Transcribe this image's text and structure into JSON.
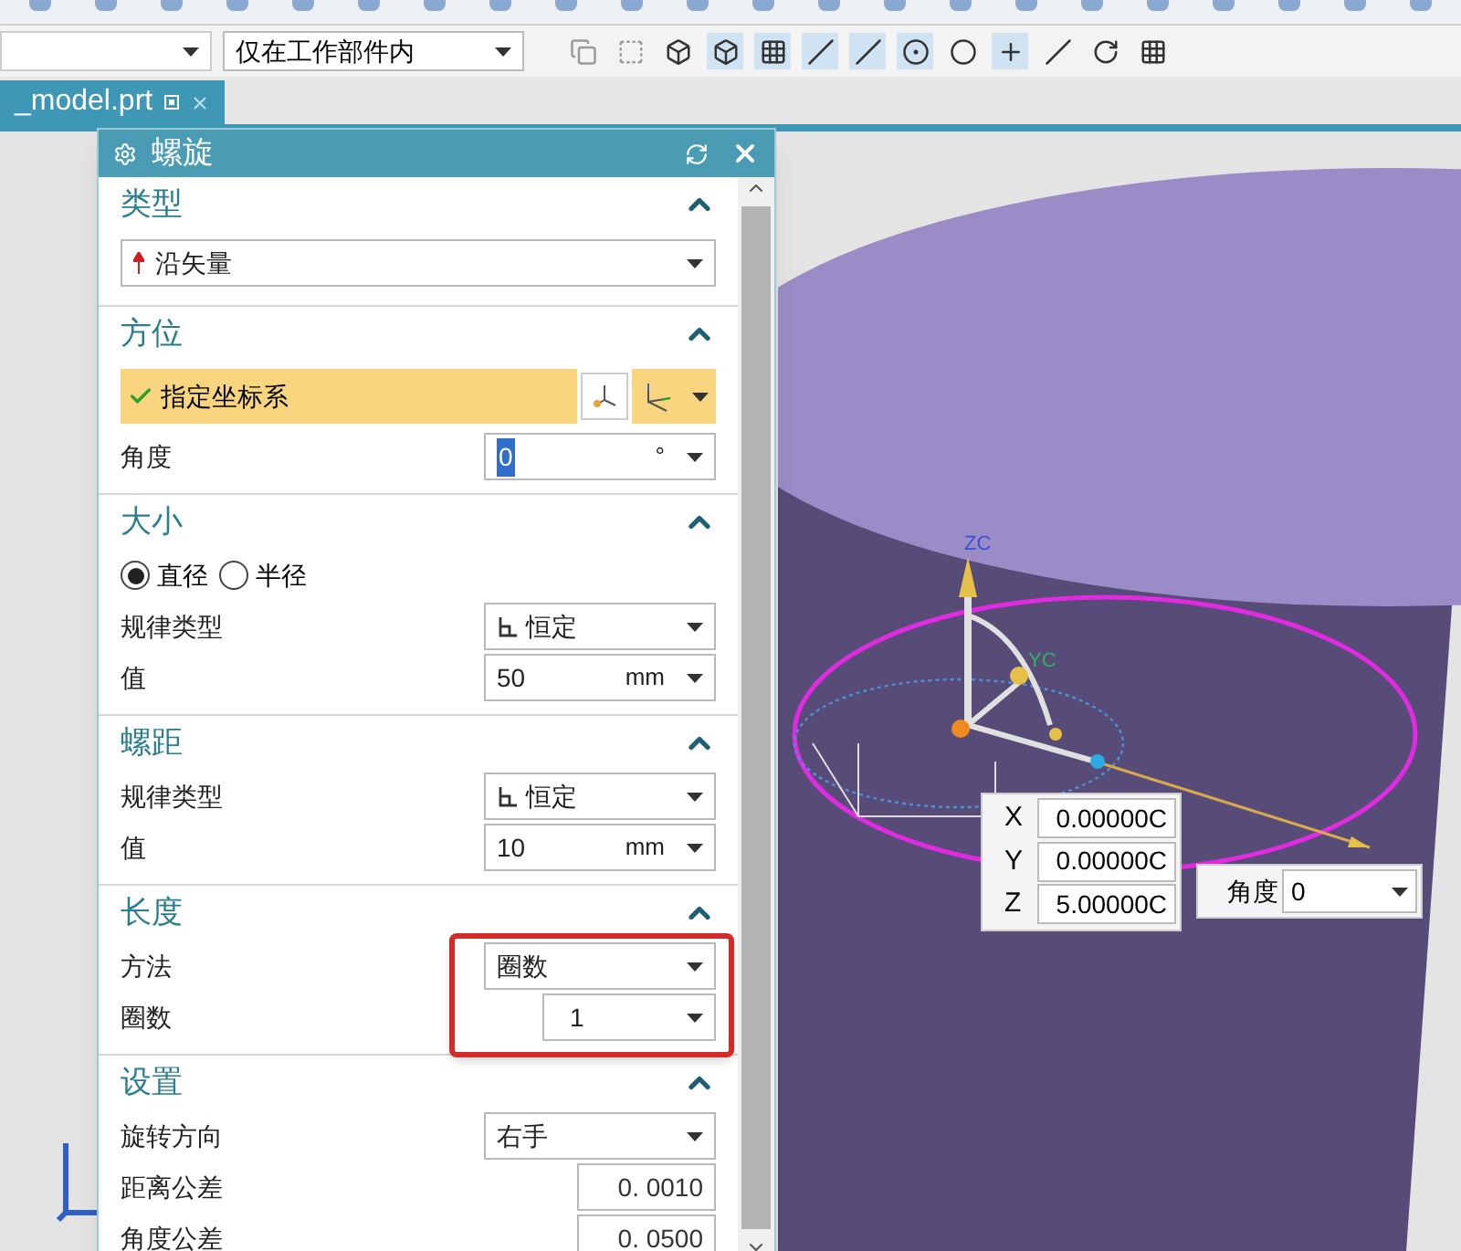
{
  "toolbar": {
    "filter_dropdown": {
      "value": "仅在工作部件内"
    }
  },
  "tabs": [
    {
      "label": "_model.prt",
      "selected": true
    }
  ],
  "dialog": {
    "title": "螺旋",
    "sections": [
      {
        "title": "类型",
        "expanded": true,
        "highlighted": false,
        "rows": [
          {
            "kind": "type_select",
            "value": "沿矢量"
          }
        ]
      },
      {
        "title": "方位",
        "expanded": true,
        "highlighted": false,
        "rows": [
          {
            "kind": "selection",
            "label": "指定坐标系",
            "checked": true
          },
          {
            "kind": "field",
            "label": "角度",
            "value": "0",
            "unit": "°",
            "text_selected": true
          }
        ]
      },
      {
        "title": "大小",
        "expanded": true,
        "highlighted": false,
        "rows": [
          {
            "kind": "radio",
            "options": [
              {
                "label": "直径",
                "selected": true
              },
              {
                "label": "半径",
                "selected": false
              }
            ]
          },
          {
            "kind": "law_select",
            "label": "规律类型",
            "value": "恒定"
          },
          {
            "kind": "field",
            "label": "值",
            "value": "50",
            "unit": "mm",
            "text_selected": false
          }
        ]
      },
      {
        "title": "螺距",
        "expanded": true,
        "highlighted": false,
        "rows": [
          {
            "kind": "law_select",
            "label": "规律类型",
            "value": "恒定"
          },
          {
            "kind": "field",
            "label": "值",
            "value": "10",
            "unit": "mm",
            "text_selected": false
          }
        ]
      },
      {
        "title": "长度",
        "expanded": true,
        "highlighted": true,
        "rows": [
          {
            "kind": "dropdown",
            "label": "方法",
            "value": "圈数"
          },
          {
            "kind": "count_select",
            "label": "圈数",
            "value": "1"
          }
        ]
      },
      {
        "title": "设置",
        "expanded": true,
        "highlighted": false,
        "rows": [
          {
            "kind": "dropdown",
            "label": "旋转方向",
            "value": "右手"
          },
          {
            "kind": "number",
            "label": "距离公差",
            "value": "0. 0010"
          },
          {
            "kind": "number",
            "label": "角度公差",
            "value": "0. 0500"
          }
        ]
      }
    ]
  },
  "viewport": {
    "z_label": "ZC",
    "y_label": "YC",
    "coordinates": [
      {
        "axis": "X",
        "value": "0.00000C"
      },
      {
        "axis": "Y",
        "value": "0.00000C"
      },
      {
        "axis": "Z",
        "value": "5.00000C"
      }
    ],
    "angle": {
      "label": "角度",
      "value": "0"
    }
  }
}
